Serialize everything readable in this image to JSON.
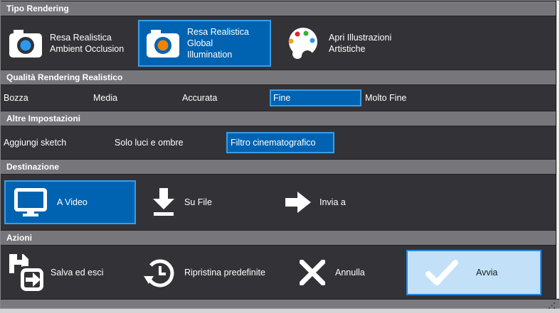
{
  "colors": {
    "window_bg": "#333337",
    "section_header_bg": "#77777b",
    "selected_fill": "#0063b1",
    "selected_border": "#3a9dea",
    "highlight_fill": "#c2e1f8",
    "highlight_border": "#2e8ae0",
    "statusbar_bg": "#7a7a7e",
    "text": "#ffffff",
    "avvia_text": "#1b1b1b",
    "lens_blue": "#2b99f0",
    "lens_orange": "#f08300",
    "dot_red": "#e02b2b",
    "dot_green": "#2fb52f",
    "dot_orange": "#f0a032",
    "dot_blue": "#2b99f0"
  },
  "sections": {
    "tipo": {
      "title": "Tipo Rendering",
      "items": [
        {
          "line1": "Resa Realistica",
          "line2": "Ambient Occlusion",
          "icon": "camera-icon",
          "selected": false
        },
        {
          "line1": "Resa Realistica Global",
          "line2": "Illumination",
          "icon": "camera-icon",
          "selected": true
        },
        {
          "line1": "Apri Illustrazioni",
          "line2": "Artistiche",
          "icon": "palette-icon",
          "selected": false
        }
      ]
    },
    "qualita": {
      "title": "Qualità Rendering Realistico",
      "items": [
        {
          "label": "Bozza",
          "selected": false
        },
        {
          "label": "Media",
          "selected": false
        },
        {
          "label": "Accurata",
          "selected": false
        },
        {
          "label": "Fine",
          "selected": true
        },
        {
          "label": "Molto Fine",
          "selected": false
        }
      ]
    },
    "altre": {
      "title": "Altre Impostazioni",
      "items": [
        {
          "label": "Aggiungi sketch",
          "selected": false
        },
        {
          "label": "Solo luci e ombre",
          "selected": false
        },
        {
          "label": "Filtro cinematografico",
          "selected": true
        }
      ]
    },
    "destinazione": {
      "title": "Destinazione",
      "items": [
        {
          "label": "A Video",
          "icon": "monitor-icon",
          "selected": true
        },
        {
          "label": "Su File",
          "icon": "download-icon",
          "selected": false
        },
        {
          "label": "Invia a",
          "icon": "arrow-right-icon",
          "selected": false
        }
      ]
    },
    "azioni": {
      "title": "Azioni",
      "items": [
        {
          "label": "Salva ed esci",
          "icon": "save-exit-icon",
          "highlighted": false
        },
        {
          "label": "Ripristina predefinite",
          "icon": "history-icon",
          "highlighted": false
        },
        {
          "label": "Annulla",
          "icon": "x-icon",
          "highlighted": false
        },
        {
          "label": "Avvia",
          "icon": "check-icon",
          "highlighted": true
        }
      ]
    }
  }
}
